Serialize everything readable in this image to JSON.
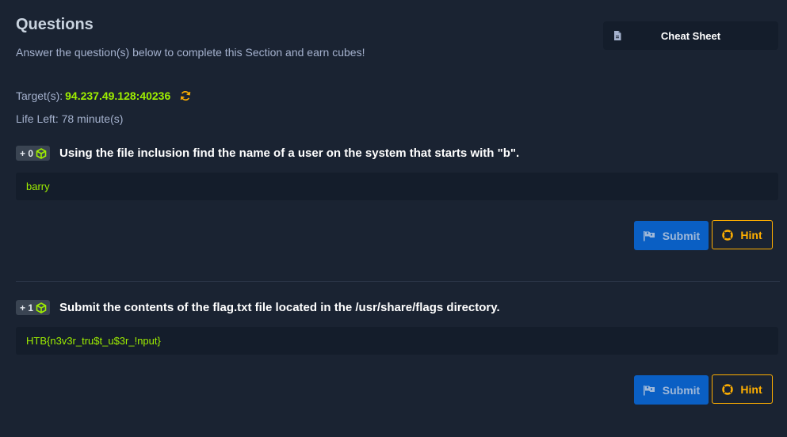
{
  "header": {
    "title": "Questions",
    "subtitle": "Answer the question(s) below to complete this Section and earn cubes!",
    "cheat_sheet_label": "Cheat Sheet"
  },
  "target": {
    "label": "Target(s):",
    "address": "94.237.49.128:40236"
  },
  "life": {
    "text": "Life Left: 78 minute(s)"
  },
  "questions": [
    {
      "reward": "+ 0",
      "text": "Using the file inclusion find the name of a user on the system that starts with \"b\".",
      "answer": "barry",
      "submit_label": "Submit",
      "hint_label": "Hint"
    },
    {
      "reward": "+ 1",
      "text": "Submit the contents of the flag.txt file located in the /usr/share/flags directory.",
      "answer": "HTB{n3v3r_tru$t_u$3r_!nput}",
      "submit_label": "Submit",
      "hint_label": "Hint"
    }
  ],
  "colors": {
    "background": "#1a2332",
    "accent_green": "#9fef00",
    "submit_blue": "#0a5fc4",
    "hint_orange": "#ffaf00"
  },
  "icons": [
    "document-icon",
    "refresh-icon",
    "cube-icon",
    "flag-icon",
    "lifebuoy-icon"
  ]
}
